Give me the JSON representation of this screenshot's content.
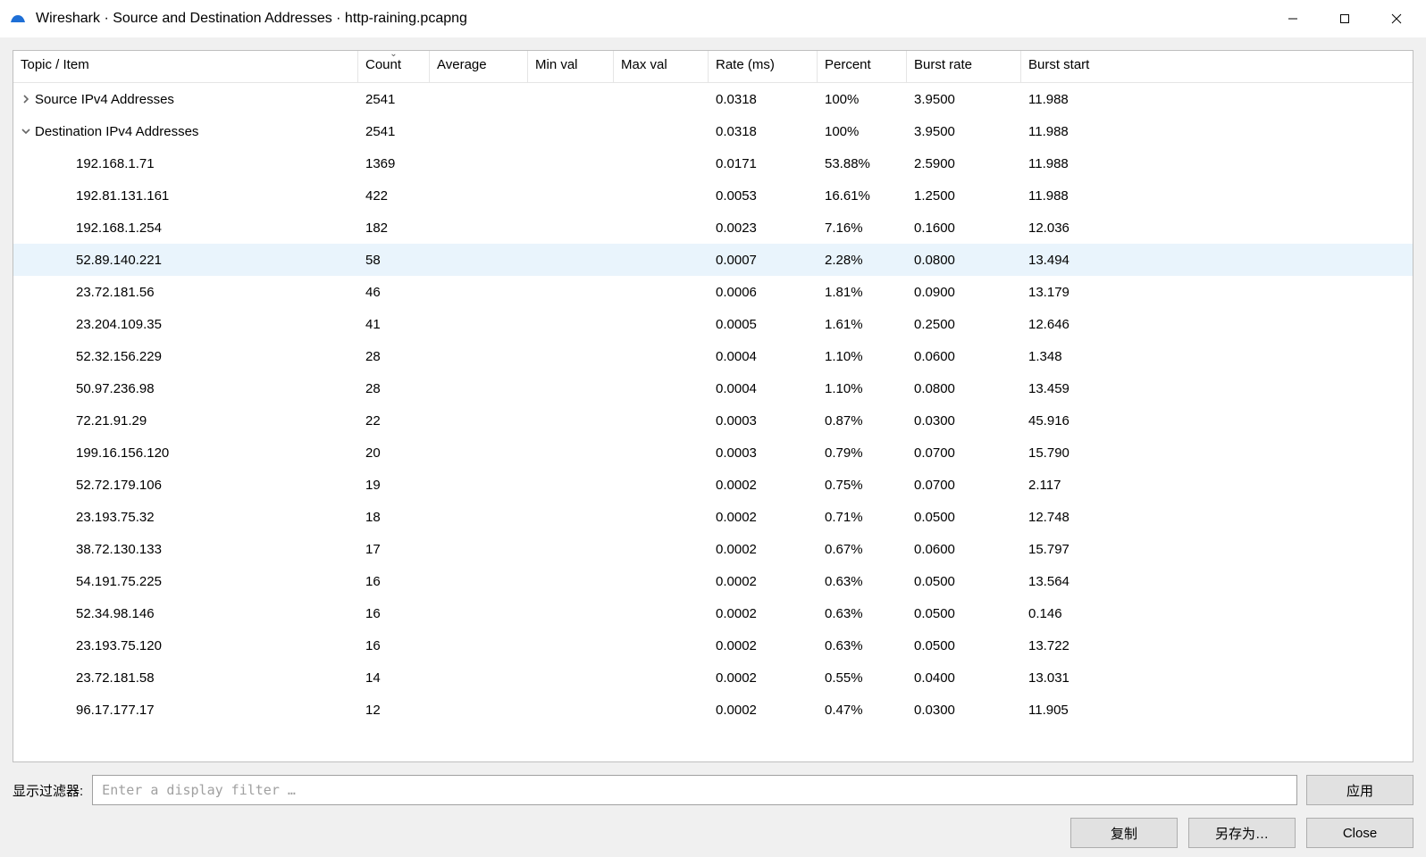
{
  "window": {
    "title": "Wireshark · Source and Destination Addresses · http-raining.pcapng"
  },
  "columns": {
    "topic": "Topic / Item",
    "count": "Count",
    "average": "Average",
    "minval": "Min val",
    "maxval": "Max val",
    "rate": "Rate (ms)",
    "percent": "Percent",
    "burstrate": "Burst rate",
    "burststart": "Burst start"
  },
  "sortColumn": "count",
  "rows": [
    {
      "level": 0,
      "exp": "collapsed",
      "topic": "Source IPv4 Addresses",
      "count": "2541",
      "avg": "",
      "min": "",
      "max": "",
      "rate": "0.0318",
      "pct": "100%",
      "brate": "3.9500",
      "bstart": "11.988",
      "hi": false
    },
    {
      "level": 0,
      "exp": "expanded",
      "topic": "Destination IPv4 Addresses",
      "count": "2541",
      "avg": "",
      "min": "",
      "max": "",
      "rate": "0.0318",
      "pct": "100%",
      "brate": "3.9500",
      "bstart": "11.988",
      "hi": false
    },
    {
      "level": 1,
      "exp": "",
      "topic": "192.168.1.71",
      "count": "1369",
      "avg": "",
      "min": "",
      "max": "",
      "rate": "0.0171",
      "pct": "53.88%",
      "brate": "2.5900",
      "bstart": "11.988",
      "hi": false
    },
    {
      "level": 1,
      "exp": "",
      "topic": "192.81.131.161",
      "count": "422",
      "avg": "",
      "min": "",
      "max": "",
      "rate": "0.0053",
      "pct": "16.61%",
      "brate": "1.2500",
      "bstart": "11.988",
      "hi": false
    },
    {
      "level": 1,
      "exp": "",
      "topic": "192.168.1.254",
      "count": "182",
      "avg": "",
      "min": "",
      "max": "",
      "rate": "0.0023",
      "pct": "7.16%",
      "brate": "0.1600",
      "bstart": "12.036",
      "hi": false
    },
    {
      "level": 1,
      "exp": "",
      "topic": "52.89.140.221",
      "count": "58",
      "avg": "",
      "min": "",
      "max": "",
      "rate": "0.0007",
      "pct": "2.28%",
      "brate": "0.0800",
      "bstart": "13.494",
      "hi": true
    },
    {
      "level": 1,
      "exp": "",
      "topic": "23.72.181.56",
      "count": "46",
      "avg": "",
      "min": "",
      "max": "",
      "rate": "0.0006",
      "pct": "1.81%",
      "brate": "0.0900",
      "bstart": "13.179",
      "hi": false
    },
    {
      "level": 1,
      "exp": "",
      "topic": "23.204.109.35",
      "count": "41",
      "avg": "",
      "min": "",
      "max": "",
      "rate": "0.0005",
      "pct": "1.61%",
      "brate": "0.2500",
      "bstart": "12.646",
      "hi": false
    },
    {
      "level": 1,
      "exp": "",
      "topic": "52.32.156.229",
      "count": "28",
      "avg": "",
      "min": "",
      "max": "",
      "rate": "0.0004",
      "pct": "1.10%",
      "brate": "0.0600",
      "bstart": "1.348",
      "hi": false
    },
    {
      "level": 1,
      "exp": "",
      "topic": "50.97.236.98",
      "count": "28",
      "avg": "",
      "min": "",
      "max": "",
      "rate": "0.0004",
      "pct": "1.10%",
      "brate": "0.0800",
      "bstart": "13.459",
      "hi": false
    },
    {
      "level": 1,
      "exp": "",
      "topic": "72.21.91.29",
      "count": "22",
      "avg": "",
      "min": "",
      "max": "",
      "rate": "0.0003",
      "pct": "0.87%",
      "brate": "0.0300",
      "bstart": "45.916",
      "hi": false
    },
    {
      "level": 1,
      "exp": "",
      "topic": "199.16.156.120",
      "count": "20",
      "avg": "",
      "min": "",
      "max": "",
      "rate": "0.0003",
      "pct": "0.79%",
      "brate": "0.0700",
      "bstart": "15.790",
      "hi": false
    },
    {
      "level": 1,
      "exp": "",
      "topic": "52.72.179.106",
      "count": "19",
      "avg": "",
      "min": "",
      "max": "",
      "rate": "0.0002",
      "pct": "0.75%",
      "brate": "0.0700",
      "bstart": "2.117",
      "hi": false
    },
    {
      "level": 1,
      "exp": "",
      "topic": "23.193.75.32",
      "count": "18",
      "avg": "",
      "min": "",
      "max": "",
      "rate": "0.0002",
      "pct": "0.71%",
      "brate": "0.0500",
      "bstart": "12.748",
      "hi": false
    },
    {
      "level": 1,
      "exp": "",
      "topic": "38.72.130.133",
      "count": "17",
      "avg": "",
      "min": "",
      "max": "",
      "rate": "0.0002",
      "pct": "0.67%",
      "brate": "0.0600",
      "bstart": "15.797",
      "hi": false
    },
    {
      "level": 1,
      "exp": "",
      "topic": "54.191.75.225",
      "count": "16",
      "avg": "",
      "min": "",
      "max": "",
      "rate": "0.0002",
      "pct": "0.63%",
      "brate": "0.0500",
      "bstart": "13.564",
      "hi": false
    },
    {
      "level": 1,
      "exp": "",
      "topic": "52.34.98.146",
      "count": "16",
      "avg": "",
      "min": "",
      "max": "",
      "rate": "0.0002",
      "pct": "0.63%",
      "brate": "0.0500",
      "bstart": "0.146",
      "hi": false
    },
    {
      "level": 1,
      "exp": "",
      "topic": "23.193.75.120",
      "count": "16",
      "avg": "",
      "min": "",
      "max": "",
      "rate": "0.0002",
      "pct": "0.63%",
      "brate": "0.0500",
      "bstart": "13.722",
      "hi": false
    },
    {
      "level": 1,
      "exp": "",
      "topic": "23.72.181.58",
      "count": "14",
      "avg": "",
      "min": "",
      "max": "",
      "rate": "0.0002",
      "pct": "0.55%",
      "brate": "0.0400",
      "bstart": "13.031",
      "hi": false
    },
    {
      "level": 1,
      "exp": "",
      "topic": "96.17.177.17",
      "count": "12",
      "avg": "",
      "min": "",
      "max": "",
      "rate": "0.0002",
      "pct": "0.47%",
      "brate": "0.0300",
      "bstart": "11.905",
      "hi": false
    }
  ],
  "filter": {
    "label": "显示过滤器:",
    "placeholder": "Enter a display filter …"
  },
  "buttons": {
    "apply": "应用",
    "copy": "复制",
    "saveas": "另存为…",
    "close": "Close"
  }
}
